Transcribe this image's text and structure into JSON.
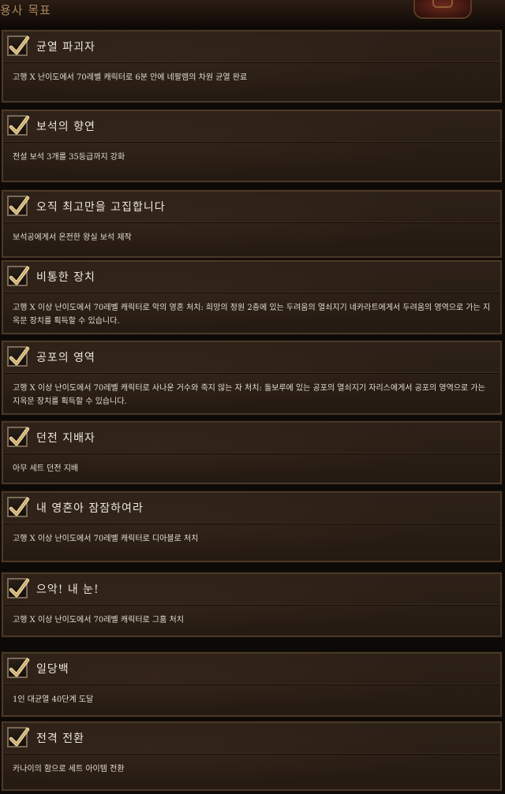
{
  "header": {
    "title": "용사 목표"
  },
  "achievements": [
    {
      "title": "균열 파괴자",
      "description": "고행 X 난이도에서 70레벨 캐릭터로 6분 안에 네팔렘의 차원 균열 완료",
      "completed": true
    },
    {
      "title": "보석의 향연",
      "description": "전설 보석 3개를 35등급까지 강화",
      "completed": true
    },
    {
      "title": "오직 최고만을 고집합니다",
      "description": "보석공에게서 온전한 왕실 보석 제작",
      "completed": true
    },
    {
      "title": "비통한 장치",
      "description": "고행 X 이상 난이도에서 70레벨 캐릭터로 악의 영혼 처치: 희망의 정원 2층에 있는 두려움의 열쇠지기 네카라트에게서 두려움의 영역으로 가는 지옥문 장치를 획득할 수 있습니다.",
      "completed": true
    },
    {
      "title": "공포의 영역",
      "description": "고행 X 이상 난이도에서 70레벨 캐릭터로 사나운 거수와 죽지 않는 자 처치: 돌보루에 있는 공포의 열쇠지기 자리스에게서 공포의 영역으로 가는 지옥문 장치를 획득할 수 있습니다.",
      "completed": true
    },
    {
      "title": "던전 지배자",
      "description": "아무 세트 던전 지배",
      "completed": true
    },
    {
      "title": "내 영혼아 잠잠하여라",
      "description": "고행 X 이상 난이도에서 70레벨 캐릭터로 디아블로 처치",
      "completed": true
    },
    {
      "title": "으악! 내 눈!",
      "description": "고행 X 이상 난이도에서 70레벨 캐릭터로 그훔 처치",
      "completed": true
    },
    {
      "title": "일당백",
      "description": "1인 대균열 40단계 도달",
      "completed": true
    },
    {
      "title": "전격 전환",
      "description": "카나이의 함으로 세트 아이템 전환",
      "completed": true
    }
  ]
}
